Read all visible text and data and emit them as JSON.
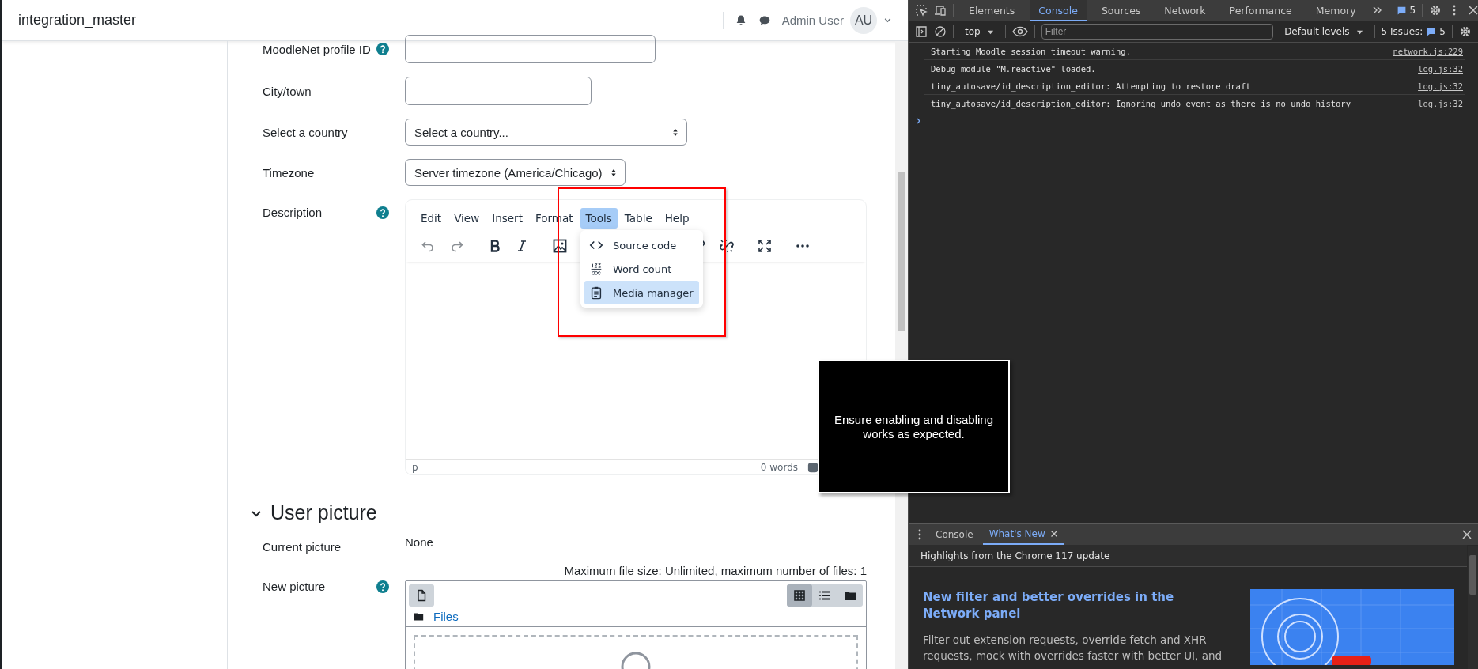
{
  "header": {
    "site_name": "integration_master",
    "user_name": "Admin User",
    "avatar_initials": "AU"
  },
  "form": {
    "fields": [
      {
        "kind": "text",
        "label": "MoodleNet profile ID",
        "help": true
      },
      {
        "kind": "text",
        "label": "City/town",
        "help": false
      },
      {
        "kind": "select",
        "label": "Select a country",
        "help": false,
        "value": "Select a country..."
      },
      {
        "kind": "select",
        "label": "Timezone",
        "help": false,
        "value": "Server timezone (America/Chicago)"
      }
    ],
    "description": {
      "label": "Description",
      "help": true,
      "editor": {
        "menus": [
          {
            "label": "Edit",
            "selected": false
          },
          {
            "label": "View",
            "selected": false
          },
          {
            "label": "Insert",
            "selected": false
          },
          {
            "label": "Format",
            "selected": false
          },
          {
            "label": "Tools",
            "selected": true
          },
          {
            "label": "Table",
            "selected": false
          },
          {
            "label": "Help",
            "selected": false
          }
        ],
        "dropdown": [
          {
            "kind": "code",
            "label": "Source code",
            "selected": false
          },
          {
            "kind": "count",
            "label": "Word count",
            "selected": false
          },
          {
            "kind": "media",
            "label": "Media manager",
            "selected": true
          }
        ],
        "path": "p",
        "word_count": "0 words"
      }
    }
  },
  "user_picture": {
    "title": "User picture",
    "expanded": true,
    "current_label": "Current picture",
    "current_value": "None",
    "new_label": "New picture",
    "new_help": true,
    "limits": "Maximum file size: Unlimited, maximum number of files: 1",
    "breadcrumb": "Files",
    "views": [
      {
        "kind": "grid",
        "selected": true
      },
      {
        "kind": "list",
        "selected": false
      },
      {
        "kind": "tree",
        "selected": false
      }
    ]
  },
  "tooltip": {
    "text": "Ensure enabling and disabling works as expected."
  },
  "devtools": {
    "tabs": [
      {
        "label": "Elements",
        "selected": false
      },
      {
        "label": "Console",
        "selected": true
      },
      {
        "label": "Sources",
        "selected": false
      },
      {
        "label": "Network",
        "selected": false
      },
      {
        "label": "Performance",
        "selected": false
      },
      {
        "label": "Memory",
        "selected": false
      }
    ],
    "message_count": "5",
    "context": "top",
    "filter_placeholder": "Filter",
    "levels": "Default levels",
    "issues_label": "5 Issues:",
    "issues_count": "5",
    "messages": [
      {
        "text": "Starting Moodle session timeout warning.",
        "source": "network.js:229"
      },
      {
        "text": "Debug module \"M.reactive\" loaded.",
        "source": "log.js:32"
      },
      {
        "text": "tiny_autosave/id_description_editor: Attempting to restore draft",
        "source": "log.js:32"
      },
      {
        "text": "tiny_autosave/id_description_editor: Ignoring undo event as there is no undo history",
        "source": "log.js:32"
      }
    ],
    "drawer": {
      "tabs": [
        {
          "label": "Console",
          "selected": false,
          "closable": false
        },
        {
          "label": "What's New",
          "selected": true,
          "closable": true
        }
      ],
      "highlights": "Highlights from the Chrome 117 update",
      "article_title": "New filter and better overrides in the Network panel",
      "article_body": "Filter out extension requests, override fetch and XHR requests, mock with overrides faster with better UI, and"
    }
  }
}
